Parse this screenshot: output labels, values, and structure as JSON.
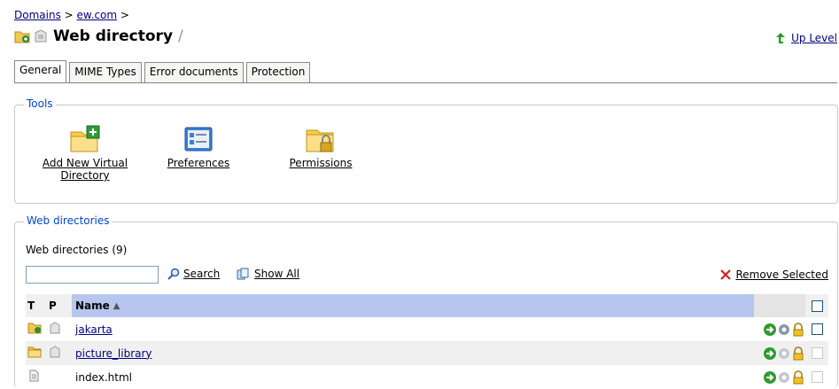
{
  "breadcrumb": {
    "domains": "Domains",
    "sep1": ">",
    "domain": "ew.com",
    "sep2": ">"
  },
  "header": {
    "title": "Web directory",
    "slash": "/",
    "up_level": "Up Level"
  },
  "tabs": [
    "General",
    "MIME Types",
    "Error documents",
    "Protection"
  ],
  "tools": {
    "legend": "Tools",
    "items": [
      {
        "label": "Add New Virtual Directory",
        "icon": "folder-add-icon"
      },
      {
        "label": "Preferences",
        "icon": "preferences-icon"
      },
      {
        "label": "Permissions",
        "icon": "folder-lock-icon"
      }
    ]
  },
  "webdirs": {
    "legend": "Web directories",
    "count_label": "Web directories (9)",
    "search_value": "",
    "search_label": "Search",
    "show_all_label": "Show All",
    "remove_label": "Remove Selected",
    "columns": {
      "t": "T",
      "p": "P",
      "name": "Name"
    },
    "rows": [
      {
        "name": "jakarta",
        "type": "virtual-folder-icon",
        "link": true
      },
      {
        "name": "picture_library",
        "type": "folder-icon",
        "link": true
      },
      {
        "name": "index.html",
        "type": "file-icon",
        "link": false
      }
    ]
  },
  "colors": {
    "header_highlight": "#b6c6ee",
    "legend": "#0046d5",
    "link": "#000080"
  }
}
